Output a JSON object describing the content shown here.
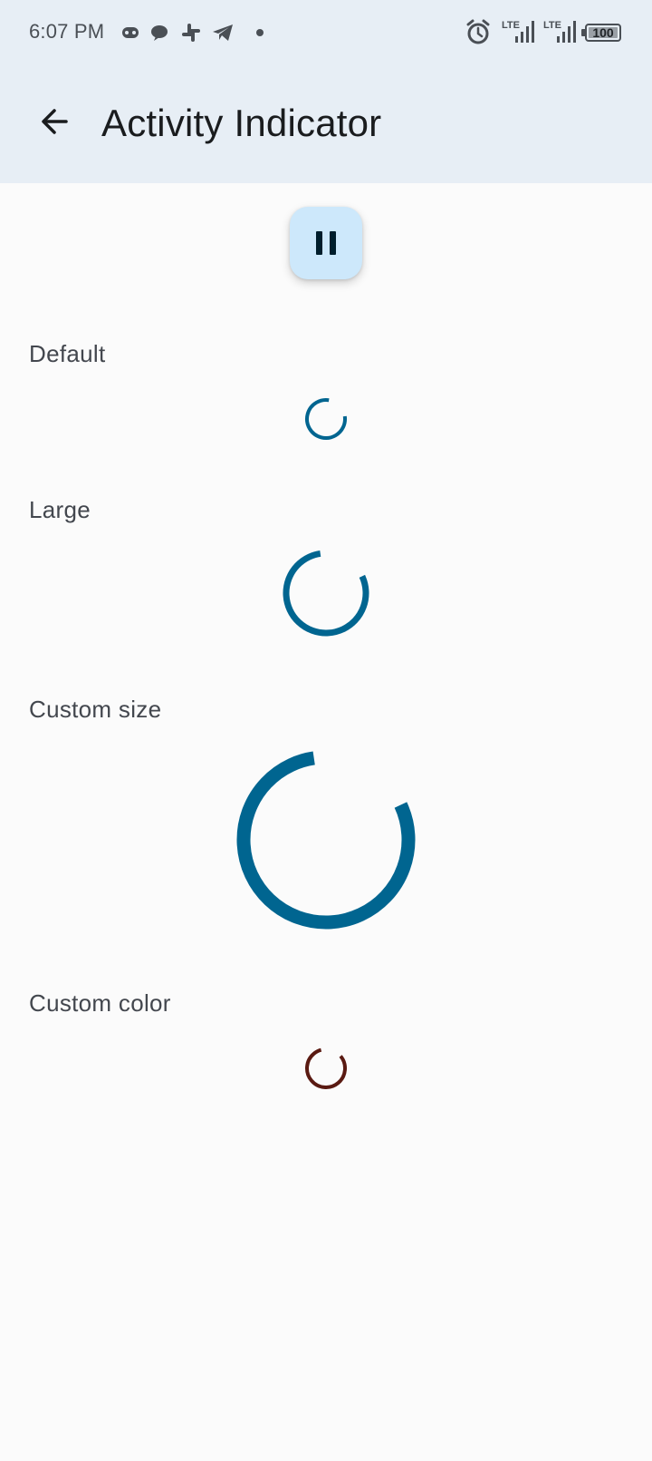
{
  "status_bar": {
    "time": "6:07 PM",
    "notification_icons": [
      "gamepad-icon",
      "chat-bubble-icon",
      "slack-icon",
      "telegram-icon",
      "dot-icon"
    ],
    "right_icons": [
      "alarm-icon",
      "signal-icon",
      "signal-icon"
    ],
    "lte_labels": [
      "LTE",
      "LTE"
    ],
    "battery_level": "100"
  },
  "app_bar": {
    "back_icon": "arrow-back-icon",
    "title": "Activity Indicator"
  },
  "fab": {
    "icon": "pause-icon",
    "background": "#cde8fb"
  },
  "sections": [
    {
      "label": "Default",
      "indicator_color": "#006590"
    },
    {
      "label": "Large",
      "indicator_color": "#006590"
    },
    {
      "label": "Custom size",
      "indicator_color": "#006590"
    },
    {
      "label": "Custom color",
      "indicator_color": "#5a1a12"
    }
  ],
  "colors": {
    "header_background": "#e7eef5",
    "page_background": "#fbfbfb",
    "primary": "#006590",
    "custom": "#5a1a12"
  }
}
